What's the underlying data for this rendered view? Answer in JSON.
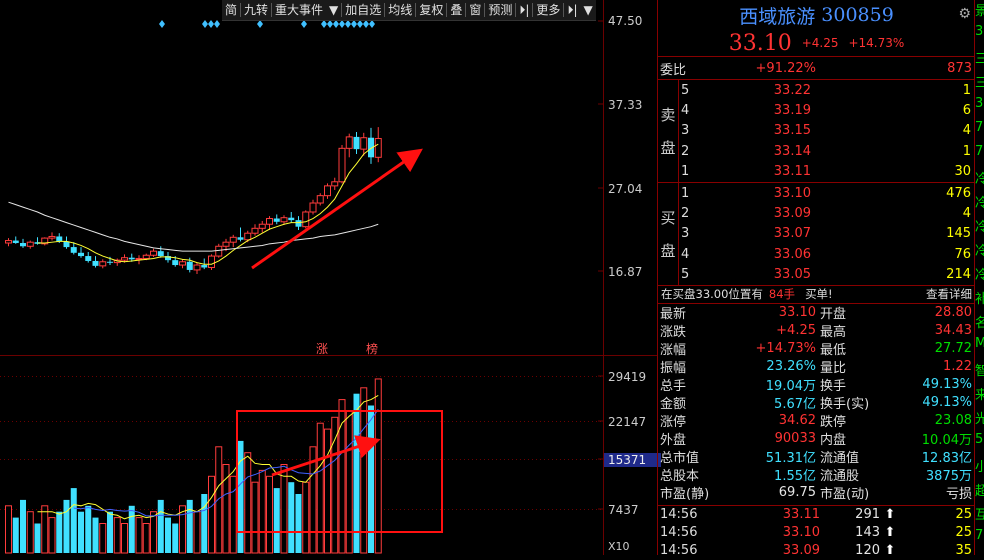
{
  "toolbar": {
    "items": [
      "简",
      "九转",
      "重大事件",
      "▼",
      "加自选",
      "均线",
      "复权",
      "叠",
      "窗",
      "预测",
      "更多"
    ],
    "nav_icon": "⏵|",
    "menu_icon": "▼"
  },
  "price_scale": [
    "47.50",
    "37.33",
    "27.04",
    "16.87"
  ],
  "volume_scale": [
    "29419",
    "22147",
    "15371",
    "7437",
    "X10"
  ],
  "tags": {
    "zhang": "涨",
    "bang": "榜"
  },
  "chart_data": {
    "type": "candlestick",
    "title": "",
    "ylim": [
      12.0,
      47.5
    ],
    "ohlc": [
      [
        20.3,
        20.9,
        19.9,
        20.6
      ],
      [
        20.6,
        21.1,
        20.2,
        20.3
      ],
      [
        20.3,
        20.8,
        19.7,
        19.9
      ],
      [
        19.9,
        20.6,
        19.6,
        20.4
      ],
      [
        20.4,
        21.0,
        20.1,
        20.2
      ],
      [
        20.2,
        21.0,
        20.0,
        20.9
      ],
      [
        20.9,
        21.6,
        20.6,
        21.1
      ],
      [
        21.1,
        21.5,
        20.3,
        20.5
      ],
      [
        20.5,
        21.1,
        19.6,
        19.8
      ],
      [
        19.8,
        20.4,
        18.9,
        19.1
      ],
      [
        19.1,
        19.8,
        18.5,
        18.7
      ],
      [
        18.7,
        19.2,
        17.9,
        18.1
      ],
      [
        18.1,
        18.7,
        17.3,
        17.5
      ],
      [
        17.5,
        18.3,
        17.2,
        18.0
      ],
      [
        18.0,
        18.6,
        17.6,
        17.9
      ],
      [
        17.9,
        18.4,
        17.5,
        18.2
      ],
      [
        18.2,
        18.9,
        17.9,
        18.5
      ],
      [
        18.5,
        19.0,
        18.0,
        18.3
      ],
      [
        18.3,
        18.8,
        17.7,
        18.4
      ],
      [
        18.4,
        19.0,
        18.2,
        18.8
      ],
      [
        18.8,
        19.6,
        18.6,
        19.3
      ],
      [
        19.3,
        19.9,
        18.5,
        18.7
      ],
      [
        18.7,
        19.2,
        17.9,
        18.2
      ],
      [
        18.2,
        18.7,
        17.4,
        17.6
      ],
      [
        17.6,
        18.3,
        17.2,
        18.0
      ],
      [
        18.0,
        18.5,
        16.7,
        17.0
      ],
      [
        17.0,
        17.9,
        16.5,
        17.6
      ],
      [
        17.6,
        18.4,
        17.1,
        17.3
      ],
      [
        17.3,
        18.9,
        17.0,
        18.7
      ],
      [
        18.7,
        20.2,
        18.5,
        19.9
      ],
      [
        19.9,
        20.8,
        19.3,
        20.4
      ],
      [
        20.4,
        21.3,
        19.8,
        21.0
      ],
      [
        21.0,
        22.2,
        20.5,
        20.7
      ],
      [
        20.7,
        21.8,
        20.4,
        21.5
      ],
      [
        21.5,
        22.6,
        21.2,
        22.1
      ],
      [
        22.1,
        23.0,
        21.6,
        22.6
      ],
      [
        22.6,
        23.6,
        21.9,
        23.3
      ],
      [
        23.3,
        23.8,
        22.6,
        22.9
      ],
      [
        22.9,
        23.7,
        22.5,
        23.4
      ],
      [
        23.4,
        24.1,
        22.8,
        23.1
      ],
      [
        23.1,
        23.6,
        21.9,
        22.3
      ],
      [
        22.3,
        24.3,
        22.1,
        24.1
      ],
      [
        24.1,
        25.6,
        23.8,
        25.2
      ],
      [
        25.2,
        26.4,
        24.9,
        26.1
      ],
      [
        26.1,
        27.6,
        25.7,
        27.3
      ],
      [
        27.3,
        28.3,
        26.8,
        27.8
      ],
      [
        27.8,
        32.3,
        27.6,
        31.9
      ],
      [
        31.9,
        33.7,
        30.8,
        33.3
      ],
      [
        33.3,
        33.9,
        31.2,
        31.8
      ],
      [
        31.8,
        33.8,
        31.0,
        33.2
      ],
      [
        33.2,
        34.4,
        30.0,
        30.8
      ],
      [
        30.8,
        34.5,
        30.2,
        33.1
      ]
    ],
    "ma_yellow": [
      null,
      null,
      null,
      null,
      20.3,
      20.3,
      20.4,
      20.5,
      20.5,
      20.3,
      20.0,
      19.6,
      19.1,
      18.7,
      18.4,
      18.1,
      18.0,
      18.1,
      18.2,
      18.3,
      18.4,
      18.6,
      18.6,
      18.5,
      18.3,
      18.2,
      17.9,
      17.7,
      17.7,
      18.1,
      18.7,
      19.4,
      20.0,
      20.6,
      21.0,
      21.5,
      22.0,
      22.3,
      22.6,
      22.8,
      22.8,
      22.9,
      23.3,
      23.9,
      24.7,
      25.7,
      27.3,
      28.9,
      30.0,
      31.2,
      31.9,
      32.4
    ],
    "ma_white": [
      25.3,
      25.0,
      24.7,
      24.4,
      24.1,
      23.7,
      23.4,
      23.1,
      22.8,
      22.5,
      22.2,
      21.9,
      21.6,
      21.3,
      21.0,
      20.8,
      20.5,
      20.3,
      20.1,
      19.9,
      19.7,
      19.6,
      19.5,
      19.4,
      19.3,
      19.3,
      19.3,
      19.3,
      19.3,
      19.4,
      19.5,
      19.6,
      19.7,
      19.8,
      19.9,
      20.0,
      20.2,
      20.3,
      20.4,
      20.6,
      20.7,
      20.8,
      20.9,
      21.1,
      21.2,
      21.3,
      21.5,
      21.7,
      21.9,
      22.1,
      22.3,
      22.6
    ],
    "volume": [
      800,
      600,
      900,
      700,
      500,
      800,
      600,
      700,
      900,
      1100,
      700,
      800,
      600,
      500,
      700,
      600,
      500,
      800,
      600,
      500,
      700,
      900,
      600,
      500,
      800,
      900,
      700,
      1000,
      1300,
      1800,
      1500,
      1300,
      1900,
      1700,
      1200,
      1400,
      1300,
      1100,
      1500,
      1200,
      1000,
      1200,
      1800,
      2200,
      2100,
      2300,
      2600,
      2400,
      2700,
      2800,
      2500,
      2950
    ],
    "vol_ylim": [
      0,
      3000
    ]
  },
  "stock": {
    "name": "西域旅游",
    "code": "300859",
    "price": "33.10",
    "change": "+4.25",
    "change_pct": "+14.73%"
  },
  "webi": {
    "label": "委比",
    "pct": "+91.22%",
    "diff": "873"
  },
  "sell": {
    "label": [
      "卖",
      "盘"
    ],
    "rows": [
      {
        "n": "5",
        "p": "33.22",
        "v": "1"
      },
      {
        "n": "4",
        "p": "33.19",
        "v": "6"
      },
      {
        "n": "3",
        "p": "33.15",
        "v": "4"
      },
      {
        "n": "2",
        "p": "33.14",
        "v": "1"
      },
      {
        "n": "1",
        "p": "33.11",
        "v": "30"
      }
    ]
  },
  "buy": {
    "label": [
      "买",
      "盘"
    ],
    "rows": [
      {
        "n": "1",
        "p": "33.10",
        "v": "476"
      },
      {
        "n": "2",
        "p": "33.09",
        "v": "4"
      },
      {
        "n": "3",
        "p": "33.07",
        "v": "145"
      },
      {
        "n": "4",
        "p": "33.06",
        "v": "76"
      },
      {
        "n": "5",
        "p": "33.05",
        "v": "214"
      }
    ]
  },
  "tip": {
    "text1": "在买盘33.00位置有",
    "count": "84手",
    "text2": "买单!",
    "link": "查看详细"
  },
  "stats": [
    {
      "l1": "最新",
      "v1": "33.10",
      "c1": "red",
      "l2": "开盘",
      "v2": "28.80",
      "c2": "red"
    },
    {
      "l1": "涨跌",
      "v1": "+4.25",
      "c1": "red",
      "l2": "最高",
      "v2": "34.43",
      "c2": "red"
    },
    {
      "l1": "涨幅",
      "v1": "+14.73%",
      "c1": "red",
      "l2": "最低",
      "v2": "27.72",
      "c2": "green"
    },
    {
      "l1": "振幅",
      "v1": "23.26%",
      "c1": "cyan",
      "l2": "量比",
      "v2": "1.22",
      "c2": "red"
    },
    {
      "l1": "总手",
      "v1": "19.04万",
      "c1": "cyan",
      "l2": "换手",
      "v2": "49.13%",
      "c2": "cyan"
    },
    {
      "l1": "金额",
      "v1": "5.67亿",
      "c1": "cyan",
      "l2": "换手(实)",
      "v2": "49.13%",
      "c2": "cyan"
    },
    {
      "l1": "涨停",
      "v1": "34.62",
      "c1": "red",
      "l2": "跌停",
      "v2": "23.08",
      "c2": "green"
    },
    {
      "l1": "外盘",
      "v1": "90033",
      "c1": "red",
      "l2": "内盘",
      "v2": "10.04万",
      "c2": "green"
    },
    {
      "l1": "总市值",
      "v1": "51.31亿",
      "c1": "cyan",
      "l2": "流通值",
      "v2": "12.83亿",
      "c2": "cyan"
    },
    {
      "l1": "总股本",
      "v1": "1.55亿",
      "c1": "cyan",
      "l2": "流通股",
      "v2": "3875万",
      "c2": "cyan"
    },
    {
      "l1": "市盈(静)",
      "v1": "69.75",
      "c1": "white",
      "l2": "市盈(动)",
      "v2": "亏损",
      "c2": "white"
    }
  ],
  "ticks": [
    {
      "t": "14:56",
      "p": "33.11",
      "v": "291",
      "a": "⬆",
      "c": "25"
    },
    {
      "t": "14:56",
      "p": "33.10",
      "v": "143",
      "a": "⬆",
      "c": "25"
    },
    {
      "t": "14:56",
      "p": "33.09",
      "v": "120",
      "a": "⬆",
      "c": "35"
    }
  ],
  "edge": [
    "景",
    "3",
    "三",
    "三",
    "3",
    "7",
    "7",
    "冷",
    "冷",
    "冷",
    "冷",
    "冷",
    "补",
    "名",
    "M",
    "智",
    "来",
    "光",
    "5",
    "小",
    "超",
    "互",
    "7"
  ],
  "colors": {
    "up": "#ff3c3c",
    "down": "#40e0ff",
    "ma_yellow": "#ffff33",
    "ma_white": "#e6e6e6",
    "arrow": "#ff1010",
    "box": "#ff1010",
    "grid": "#6b0000"
  }
}
